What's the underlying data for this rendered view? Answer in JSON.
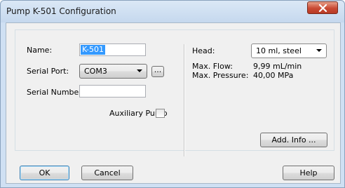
{
  "window": {
    "title": "Pump K-501 Configuration"
  },
  "left": {
    "name_label": "Name:",
    "name_value": "K-501",
    "serial_port_label": "Serial Port:",
    "serial_port_value": "COM3",
    "browse_label": "...",
    "serial_number_label": "Serial Number:",
    "serial_number_value": "",
    "auxiliary_pump_label": "Auxiliary Pump",
    "auxiliary_pump_checked": false
  },
  "right": {
    "head_label": "Head:",
    "head_value": "10 ml, steel",
    "max_flow_label": "Max. Flow:",
    "max_flow_value": "9,99 mL/min",
    "max_pressure_label": "Max. Pressure:",
    "max_pressure_value": "40,00 MPa",
    "add_info_label": "Add. Info ..."
  },
  "footer": {
    "ok_label": "OK",
    "cancel_label": "Cancel",
    "help_label": "Help"
  },
  "colors": {
    "selection": "#3399ff",
    "close_button": "#c94a33",
    "title_bar": "#cfe0f3"
  }
}
